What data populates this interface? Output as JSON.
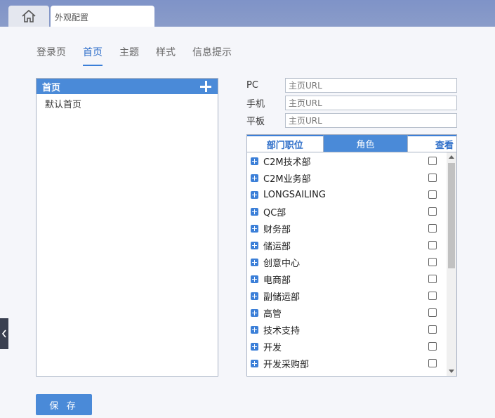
{
  "window": {
    "tab_title": "外观配置",
    "home_icon": "home-icon"
  },
  "subtabs": [
    {
      "label": "登录页",
      "active": false
    },
    {
      "label": "首页",
      "active": true
    },
    {
      "label": "主题",
      "active": false
    },
    {
      "label": "样式",
      "active": false
    },
    {
      "label": "信息提示",
      "active": false
    }
  ],
  "left_panel": {
    "header": "首页",
    "add_icon": "plus-icon",
    "items": [
      "默认首页"
    ]
  },
  "urls": {
    "pc": {
      "label": "PC",
      "placeholder": "主页URL",
      "value": ""
    },
    "mobile": {
      "label": "手机",
      "placeholder": "主页URL",
      "value": ""
    },
    "tablet": {
      "label": "平板",
      "placeholder": "主页URL",
      "value": ""
    }
  },
  "role_box": {
    "tabs": [
      "部门职位",
      "角色",
      "查看"
    ],
    "items": [
      "C2M技术部",
      "C2M业务部",
      "LONGSAILING",
      "QC部",
      "财务部",
      "储运部",
      "创意中心",
      "电商部",
      "副储运部",
      "高管",
      "技术支持",
      "开发",
      "开发采购部"
    ]
  },
  "save_label": "保 存",
  "colors": {
    "accent": "#4a8ad8",
    "topbar": "#8a9cc9",
    "active_text": "#2f6fc9"
  }
}
